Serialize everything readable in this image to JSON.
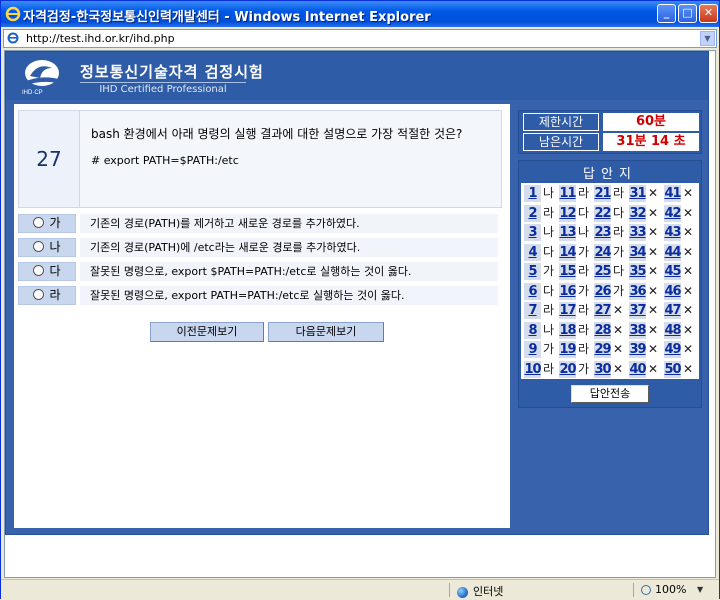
{
  "window": {
    "title": "자격검정-한국정보통신인력개발센터 - Windows Internet Explorer",
    "url": "http://test.ihd.or.kr/ihd.php",
    "minimize_glyph": "_",
    "maximize_glyph": "□",
    "close_glyph": "✕"
  },
  "header": {
    "logo_text": "IHD·CP",
    "title": "정보통신기술자격  검정시험",
    "subtitle": "IHD Certified Professional"
  },
  "question": {
    "number": "27",
    "text": "bash 환경에서 아래 명령의 실행 결과에 대한 설명으로 가장 적절한 것은?",
    "code": "# export PATH=$PATH:/etc",
    "options": [
      {
        "label": "가",
        "text": "기존의 경로(PATH)를 제거하고 새로운 경로를 추가하였다."
      },
      {
        "label": "나",
        "text": "기존의 경로(PATH)에 /etc라는 새로운 경로를 추가하였다."
      },
      {
        "label": "다",
        "text": "잘못된 명령으로, export $PATH=PATH:/etc로 실행하는 것이 옳다."
      },
      {
        "label": "라",
        "text": "잘못된 명령으로, export PATH=PATH:/etc로 실행하는 것이 옳다."
      }
    ],
    "prev_button": "이전문제보기",
    "next_button": "다음문제보기"
  },
  "timer": {
    "limit_label": "제한시간",
    "limit_value": "60분",
    "remaining_label": "남은시간",
    "remaining_value": "31분 14 초"
  },
  "answer_sheet": {
    "title": "답안지",
    "submit_label": "답안전송",
    "answers": [
      {
        "no": "1",
        "ans": "나"
      },
      {
        "no": "2",
        "ans": "라"
      },
      {
        "no": "3",
        "ans": "나"
      },
      {
        "no": "4",
        "ans": "다"
      },
      {
        "no": "5",
        "ans": "가"
      },
      {
        "no": "6",
        "ans": "다"
      },
      {
        "no": "7",
        "ans": "라"
      },
      {
        "no": "8",
        "ans": "나"
      },
      {
        "no": "9",
        "ans": "가"
      },
      {
        "no": "10",
        "ans": "라"
      },
      {
        "no": "11",
        "ans": "라"
      },
      {
        "no": "12",
        "ans": "다"
      },
      {
        "no": "13",
        "ans": "나"
      },
      {
        "no": "14",
        "ans": "가"
      },
      {
        "no": "15",
        "ans": "라"
      },
      {
        "no": "16",
        "ans": "가"
      },
      {
        "no": "17",
        "ans": "라"
      },
      {
        "no": "18",
        "ans": "라"
      },
      {
        "no": "19",
        "ans": "라"
      },
      {
        "no": "20",
        "ans": "가"
      },
      {
        "no": "21",
        "ans": "라"
      },
      {
        "no": "22",
        "ans": "다"
      },
      {
        "no": "23",
        "ans": "라"
      },
      {
        "no": "24",
        "ans": "가"
      },
      {
        "no": "25",
        "ans": "다"
      },
      {
        "no": "26",
        "ans": "가"
      },
      {
        "no": "27",
        "ans": "✕"
      },
      {
        "no": "28",
        "ans": "✕"
      },
      {
        "no": "29",
        "ans": "✕"
      },
      {
        "no": "30",
        "ans": "✕"
      },
      {
        "no": "31",
        "ans": "✕"
      },
      {
        "no": "32",
        "ans": "✕"
      },
      {
        "no": "33",
        "ans": "✕"
      },
      {
        "no": "34",
        "ans": "✕"
      },
      {
        "no": "35",
        "ans": "✕"
      },
      {
        "no": "36",
        "ans": "✕"
      },
      {
        "no": "37",
        "ans": "✕"
      },
      {
        "no": "38",
        "ans": "✕"
      },
      {
        "no": "39",
        "ans": "✕"
      },
      {
        "no": "40",
        "ans": "✕"
      },
      {
        "no": "41",
        "ans": "✕"
      },
      {
        "no": "42",
        "ans": "✕"
      },
      {
        "no": "43",
        "ans": "✕"
      },
      {
        "no": "44",
        "ans": "✕"
      },
      {
        "no": "45",
        "ans": "✕"
      },
      {
        "no": "46",
        "ans": "✕"
      },
      {
        "no": "47",
        "ans": "✕"
      },
      {
        "no": "48",
        "ans": "✕"
      },
      {
        "no": "49",
        "ans": "✕"
      },
      {
        "no": "50",
        "ans": "✕"
      }
    ]
  },
  "statusbar": {
    "zone": "인터넷",
    "zoom": "100%",
    "zoom_arrow": "▼"
  },
  "colors": {
    "page_blue": "#3863ac",
    "timer_red": "#d00000",
    "option_label_bg": "#c8d6ee"
  }
}
